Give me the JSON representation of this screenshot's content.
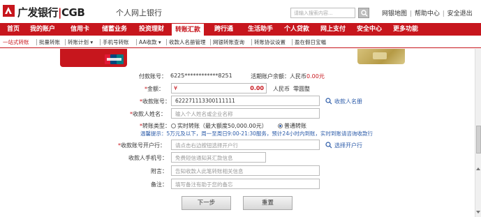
{
  "header": {
    "bank_name": "广发银行",
    "bank_sep": "|",
    "bank_en": "CGB",
    "subtitle": "个人网上银行",
    "search_placeholder": "请输入搜索内容...",
    "links": [
      "网银地图",
      "帮助中心",
      "安全退出"
    ]
  },
  "main_nav": [
    "首页",
    "我的账户",
    "信用卡",
    "储蓄业务",
    "投资理财",
    "转账汇款",
    "跨行通",
    "生活助手",
    "个人贷款",
    "网上支付",
    "安全中心",
    "更多功能"
  ],
  "main_nav_active": "转账汇款",
  "sub_nav": [
    "一站式转账",
    "批量转账",
    "转账计划",
    "手机号转账",
    "AA收款",
    "收款人名册管理",
    "网银转账查询",
    "转账协议设置",
    "盈在假日宝幅"
  ],
  "form": {
    "payer_account_label": "付款账号：",
    "payer_account_value": "6225************8251",
    "balance_label": "活期账户余额：",
    "balance_currency": "人民币",
    "balance_value": "0.00元",
    "amount_label": "金额：",
    "amount_symbol": "¥",
    "amount_value": "0.00",
    "amount_currency": "人民币",
    "amount_words": "零圆整",
    "payee_account_label": "收款账号：",
    "payee_account_value": "622271113300111111",
    "payee_list_link": "收款人名册",
    "payee_name_label": "收款人姓名：",
    "payee_name_placeholder": "输入个人姓名或企业名称",
    "transfer_type_label": "转账类型：",
    "transfer_type_realtime": "实时转账（最大额度50,000.00元）",
    "transfer_type_normal": "普通转账",
    "tip_label": "温馨提示：",
    "tip_text": "5万元及以下，周一至周日9:00-21:30服务，预计24小时内到账，实时到账请咨询收款行",
    "bank_label": "收款账号开户行：",
    "bank_placeholder": "请点击右边按钮选择开户行",
    "bank_select_link": "选择开户行",
    "phone_label": "收款人手机号：",
    "phone_placeholder": "免费短信通知其汇款信息",
    "postscript_label": "附言：",
    "postscript_placeholder": "告知收款人此笔转账相关信息",
    "remark_label": "备注：",
    "remark_placeholder": "填写备注有助于您的备忘",
    "required_mark": "*"
  },
  "buttons": {
    "next": "下一步",
    "reset": "重置"
  },
  "colors": {
    "brand_red": "#c7161d",
    "link_blue": "#2a5aa8"
  }
}
